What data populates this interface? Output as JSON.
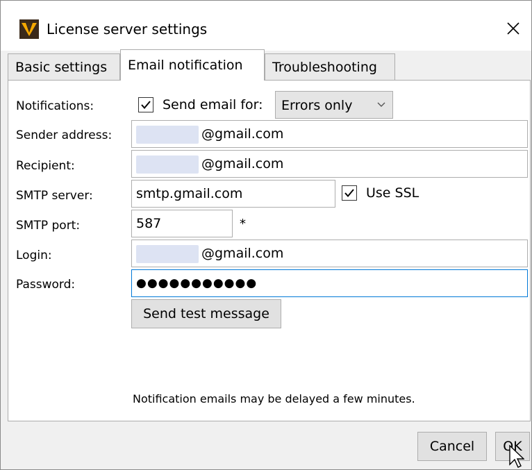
{
  "window": {
    "title": "License server settings"
  },
  "tabs": [
    {
      "label": "Basic settings"
    },
    {
      "label": "Email notification"
    },
    {
      "label": "Troubleshooting"
    }
  ],
  "form": {
    "notifications_label": "Notifications:",
    "send_email_label": "Send email for:",
    "send_email_checked": true,
    "send_email_option": "Errors only",
    "sender_label": "Sender address:",
    "sender_value": "@gmail.com",
    "recipient_label": "Recipient:",
    "recipient_value": "@gmail.com",
    "smtp_server_label": "SMTP server:",
    "smtp_server_value": "smtp.gmail.com",
    "use_ssl_label": "Use SSL",
    "use_ssl_checked": true,
    "smtp_port_label": "SMTP port:",
    "smtp_port_value": "587",
    "smtp_port_required": "*",
    "login_label": "Login:",
    "login_value": "@gmail.com",
    "password_label": "Password:",
    "password_value": "●●●●●●●●●●●",
    "send_test_label": "Send test message",
    "note": "Notification emails may be delayed a few minutes."
  },
  "footer": {
    "cancel_label": "Cancel",
    "ok_label": "OK"
  },
  "colors": {
    "accent": "#0078d7",
    "redacted": "#dde3f3"
  }
}
